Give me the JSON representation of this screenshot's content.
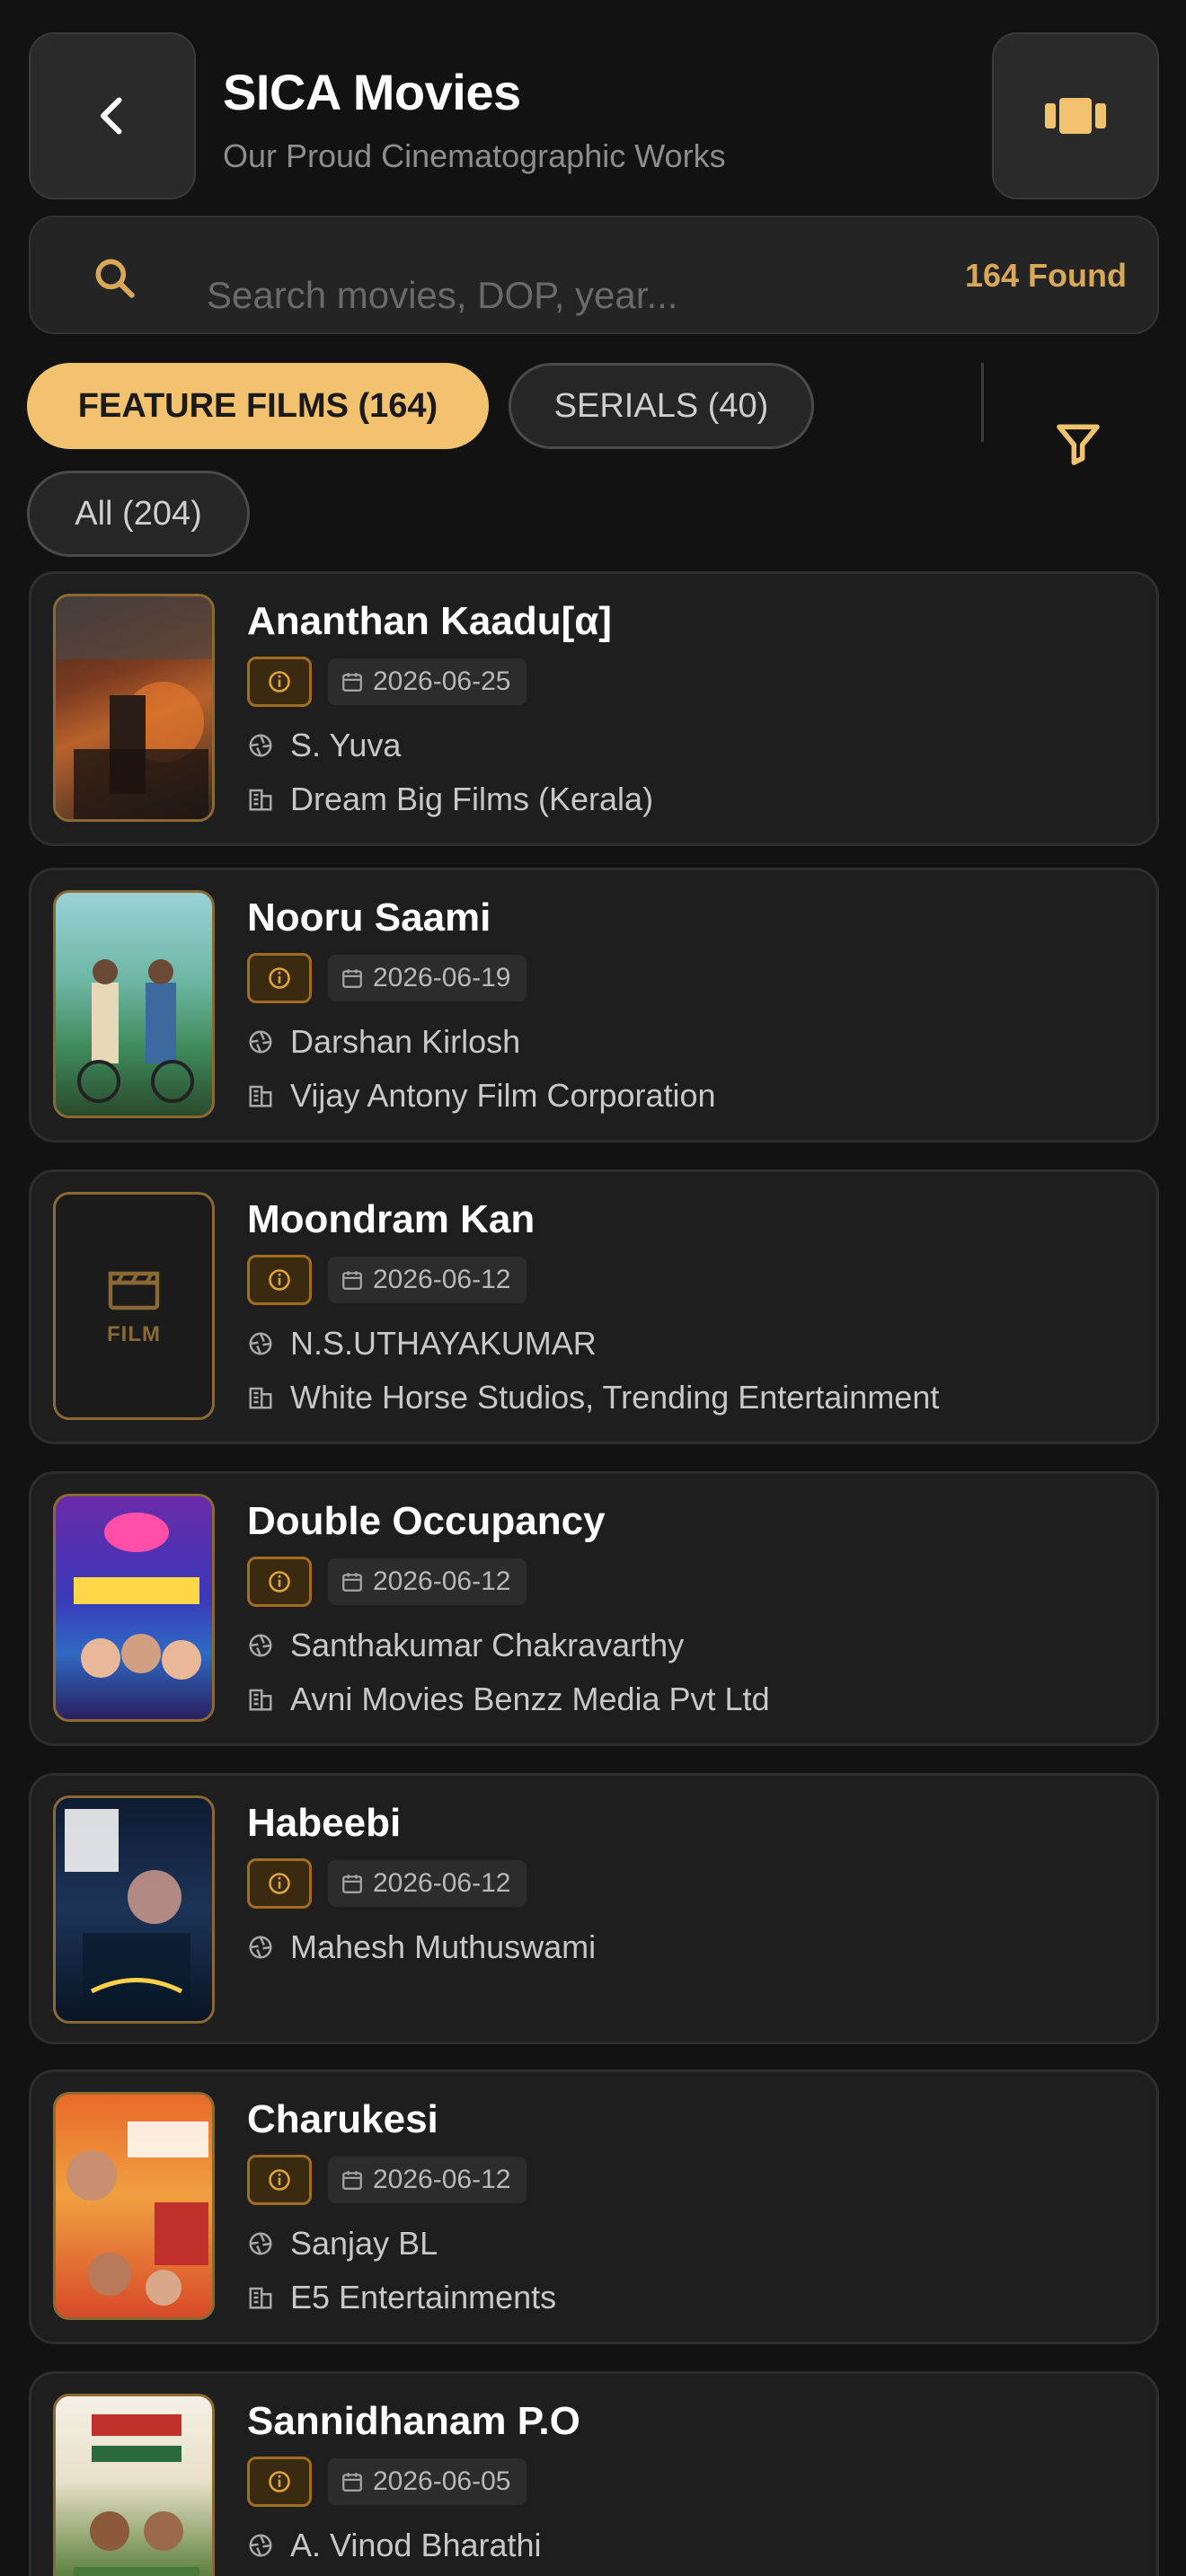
{
  "header": {
    "title": "SICA Movies",
    "subtitle": "Our Proud Cinematographic Works",
    "back_icon": "chevron-left-icon",
    "view_icon": "carousel-icon"
  },
  "search": {
    "placeholder": "Search movies, DOP, year...",
    "value": "",
    "found_count": "164 Found"
  },
  "tabs": [
    {
      "label": "FEATURE FILMS (164)",
      "active": true
    },
    {
      "label": "SERIALS (40)",
      "active": false
    },
    {
      "label": "All (204)",
      "active": false
    }
  ],
  "movies": [
    {
      "title": "Ananthan Kaadu[α]",
      "date": "2026-06-25",
      "dop": "S. Yuva",
      "production": "Dream Big Films (Kerala)"
    },
    {
      "title": "Nooru Saami",
      "date": "2026-06-19",
      "dop": "Darshan Kirlosh",
      "production": "Vijay Antony Film Corporation"
    },
    {
      "title": "Moondram Kan",
      "date": "2026-06-12",
      "dop": "N.S.UTHAYAKUMAR",
      "production": "White Horse Studios, Trending Entertainment",
      "poster_placeholder": "FILM"
    },
    {
      "title": "Double Occupancy",
      "date": "2026-06-12",
      "dop": "Santhakumar Chakravarthy",
      "production": "Avni Movies Benzz Media Pvt Ltd"
    },
    {
      "title": "Habeebi",
      "date": "2026-06-12",
      "dop": "Mahesh Muthuswami",
      "production": ""
    },
    {
      "title": "Charukesi",
      "date": "2026-06-12",
      "dop": "Sanjay BL",
      "production": "E5 Entertainments"
    },
    {
      "title": "Sannidhanam P.O",
      "date": "2026-06-05",
      "dop": "A. Vinod Bharathi",
      "production": ""
    }
  ],
  "colors": {
    "background": "#121212",
    "card": "#1e1e1e",
    "accent": "#f3c26e",
    "accent_text": "#d8a757"
  }
}
